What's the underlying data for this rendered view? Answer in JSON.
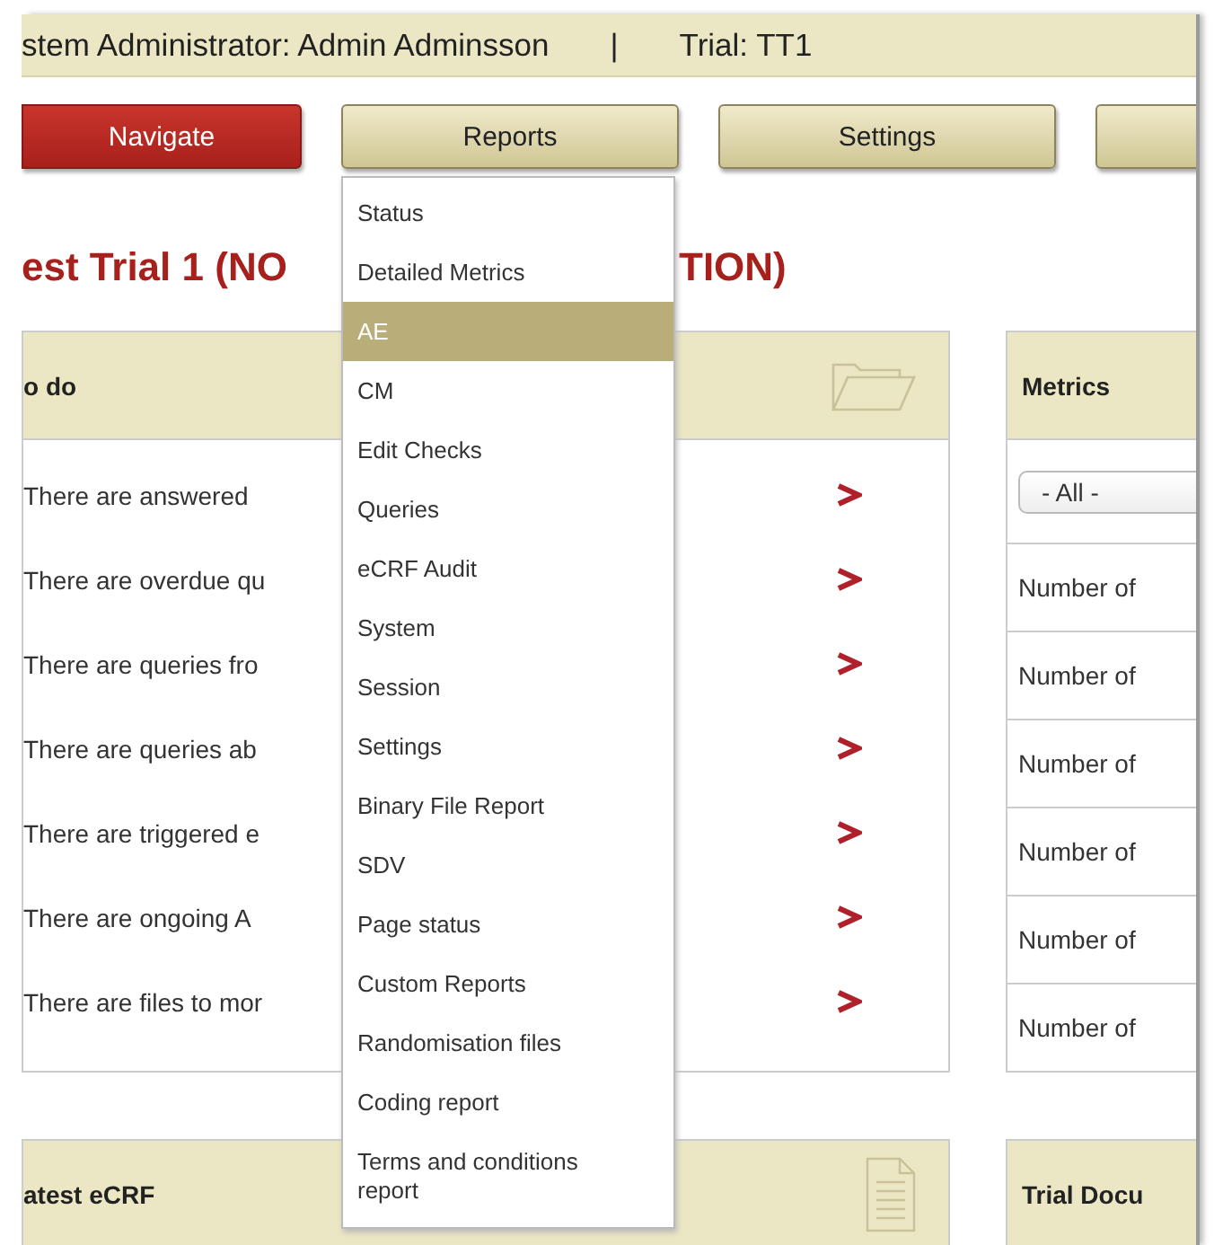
{
  "top_bar": {
    "user": "stem Administrator: Admin Adminsson",
    "separator": "|",
    "trial": "Trial: TT1"
  },
  "nav": {
    "buttons": [
      {
        "label": "Navigate",
        "selected": true
      },
      {
        "label": "Reports",
        "selected": false,
        "menu": [
          {
            "label": "Status",
            "selected": false
          },
          {
            "label": "Detailed Metrics",
            "selected": false
          },
          {
            "label": "AE",
            "selected": true
          },
          {
            "label": "CM",
            "selected": false
          },
          {
            "label": "Edit Checks",
            "selected": false
          },
          {
            "label": "Queries",
            "selected": false
          },
          {
            "label": "eCRF Audit",
            "selected": false
          },
          {
            "label": "System",
            "selected": false
          },
          {
            "label": "Session",
            "selected": false
          },
          {
            "label": "Settings",
            "selected": false
          },
          {
            "label": "Binary File Report",
            "selected": false
          },
          {
            "label": "SDV",
            "selected": false
          },
          {
            "label": "Page status",
            "selected": false
          },
          {
            "label": "Custom Reports",
            "selected": false
          },
          {
            "label": "Randomisation files",
            "selected": false
          },
          {
            "label": "Coding report",
            "selected": false
          },
          {
            "label": "Terms and conditions report",
            "selected": false
          }
        ]
      },
      {
        "label": "Settings",
        "selected": false
      },
      {
        "selected": false
      }
    ]
  },
  "title": {
    "parts": [
      "est Trial 1 (NO",
      "TION)"
    ]
  },
  "todo": {
    "title": "o do",
    "items": [
      "There are answered",
      "There are overdue qu",
      "There are queries fro",
      "There are queries ab",
      "There are triggered e",
      "There are ongoing A",
      "There are files to mor"
    ]
  },
  "metrics": {
    "title": "Metrics",
    "filter": "- All -",
    "rows": [
      "Number of",
      "Number of",
      "Number of",
      "Number of",
      "Number of",
      "Number of"
    ]
  },
  "bottom": {
    "left_title": "atest eCRF",
    "right_title": "Trial Docu"
  }
}
